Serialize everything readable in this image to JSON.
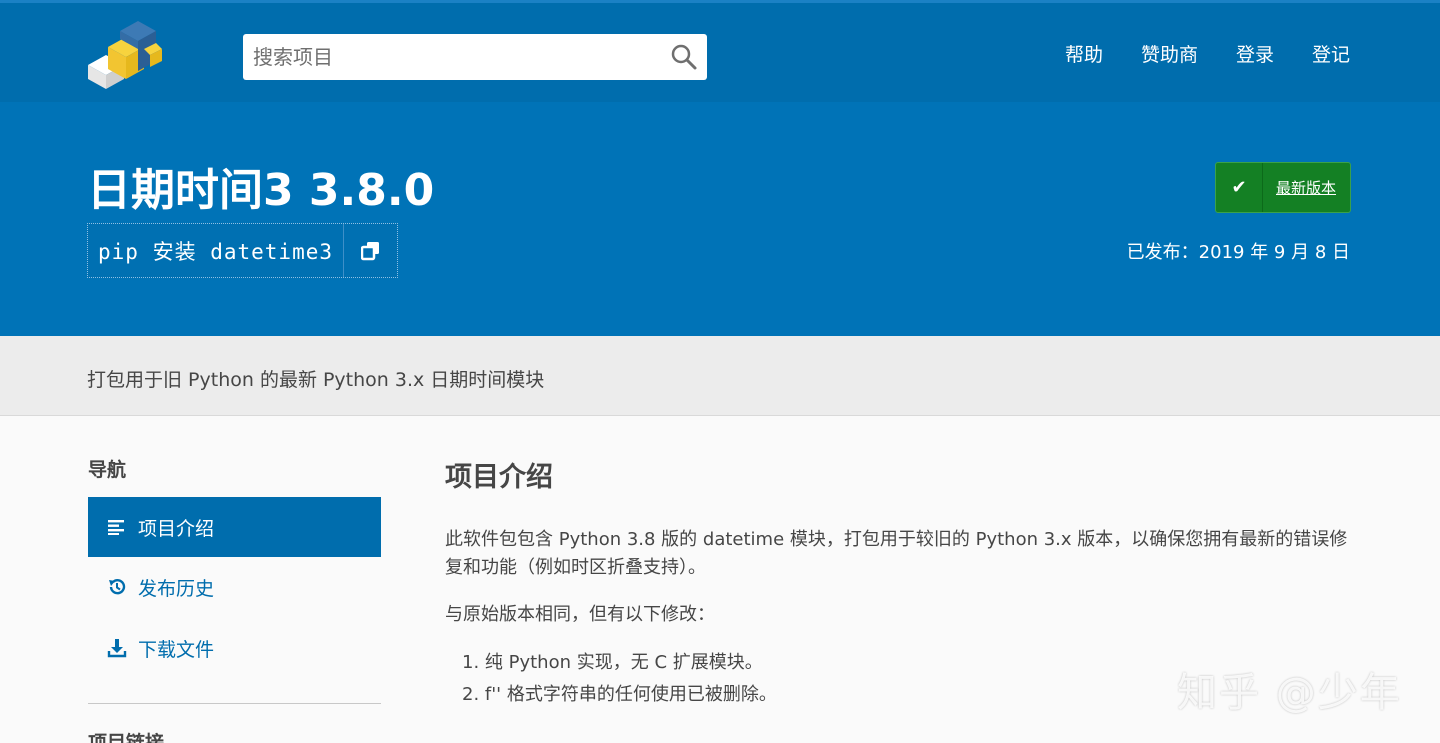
{
  "header": {
    "search_placeholder": "搜索项目",
    "nav": [
      "帮助",
      "赞助商",
      "登录",
      "登记"
    ]
  },
  "hero": {
    "title": "日期时间3 3.8.0",
    "pip_command": "pip 安装 datetime3",
    "latest_label": "最新版本",
    "released": "已发布：2019 年 9 月 8 日"
  },
  "summary": "打包用于旧 Python 的最新 Python 3.x 日期时间模块",
  "sidebar": {
    "heading": "导航",
    "items": [
      {
        "label": "项目介绍",
        "icon": "align-left-icon",
        "active": true
      },
      {
        "label": "发布历史",
        "icon": "history-icon",
        "active": false
      },
      {
        "label": "下载文件",
        "icon": "download-icon",
        "active": false
      }
    ],
    "heading2": "项目链接"
  },
  "main": {
    "heading": "项目介绍",
    "para1": "此软件包包含 Python 3.8 版的 datetime 模块，打包用于较旧的 Python 3.x 版本，以确保您拥有最新的错误修复和功能（例如时区折叠支持）。",
    "para2": "与原始版本相同，但有以下修改：",
    "list": [
      "1. 纯 Python 实现，无 C 扩展模块。",
      "2. f'' 格式字符串的任何使用已被删除。"
    ]
  },
  "watermark": "知乎 @少年",
  "colors": {
    "header_bg": "#006dad",
    "hero_bg": "#0073b7",
    "latest_btn": "#148024"
  }
}
